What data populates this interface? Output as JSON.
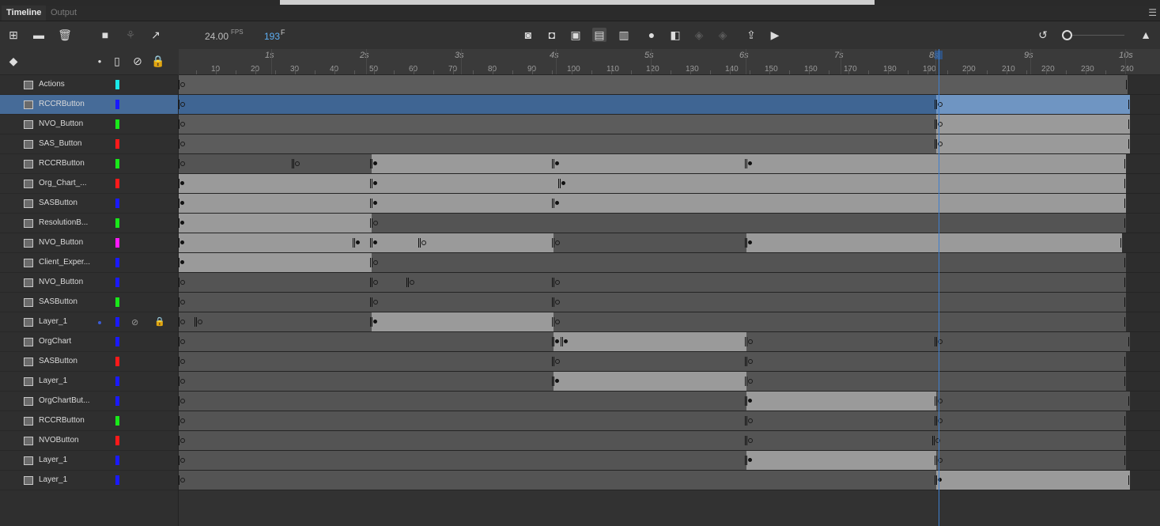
{
  "tabs": {
    "timeline": "Timeline",
    "output": "Output"
  },
  "toolbar": {
    "fps": "24.00",
    "fps_unit": "FPS",
    "current_frame": "193",
    "frame_unit": "F"
  },
  "ruler": {
    "seconds": [
      "1s",
      "2s",
      "3s",
      "4s",
      "5s",
      "6s",
      "7s",
      "8s",
      "9s",
      "10s"
    ],
    "frames": [
      "10",
      "20",
      "30",
      "40",
      "50",
      "60",
      "70",
      "80",
      "90",
      "100",
      "110",
      "120",
      "130",
      "140",
      "150",
      "160",
      "170",
      "180",
      "190",
      "200",
      "210",
      "220",
      "230",
      "240"
    ]
  },
  "layers": [
    {
      "name": "Actions",
      "color": "#19e8e8"
    },
    {
      "name": "RCCRButton",
      "color": "#1a1aff",
      "selected": true
    },
    {
      "name": "NVO_Button",
      "color": "#19e819"
    },
    {
      "name": "SAS_Button",
      "color": "#ff1a1a"
    },
    {
      "name": "RCCRButton",
      "color": "#19e819"
    },
    {
      "name": "Org_Chart_...",
      "color": "#ff1a1a"
    },
    {
      "name": "SASButton",
      "color": "#1a1aff"
    },
    {
      "name": "ResolutionB...",
      "color": "#19e819"
    },
    {
      "name": "NVO_Button",
      "color": "#ff19ff"
    },
    {
      "name": "Client_Exper...",
      "color": "#1a1aff"
    },
    {
      "name": "NVO_Button",
      "color": "#1a1aff"
    },
    {
      "name": "SASButton",
      "color": "#19e819"
    },
    {
      "name": "Layer_1",
      "color": "#1a1aff",
      "hidden_locked": true
    },
    {
      "name": "OrgChart",
      "color": "#1a1aff"
    },
    {
      "name": "SASButton",
      "color": "#ff1a1a"
    },
    {
      "name": "Layer_1",
      "color": "#1a1aff"
    },
    {
      "name": "OrgChartBut...",
      "color": "#1a1aff"
    },
    {
      "name": "RCCRButton",
      "color": "#19e819"
    },
    {
      "name": "NVOButton",
      "color": "#ff1a1a"
    },
    {
      "name": "Layer_1",
      "color": "#1a1aff"
    },
    {
      "name": "Layer_1",
      "color": "#1a1aff"
    }
  ],
  "icons": {
    "new_layer": "plus-square-icon",
    "new_folder": "folder-icon",
    "delete": "trash-icon",
    "camera": "camera-icon",
    "parenting": "hierarchy-icon",
    "graph": "graph-icon",
    "play": "play-icon",
    "loop": "loop-icon"
  },
  "colors": {
    "accent": "#3d7fd0",
    "selected_row": "#466b98"
  }
}
